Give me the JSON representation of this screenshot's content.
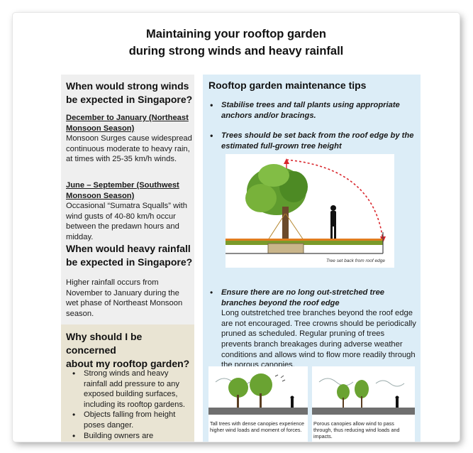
{
  "title": {
    "line1": "Maintaining your rooftop garden",
    "line2": "during strong winds and heavy rainfall"
  },
  "winds": {
    "heading_line1": "When would strong winds",
    "heading_line2": "be expected in Singapore?",
    "ne_label_line1": "December to January (Northeast",
    "ne_label_line2": "Monsoon Season)",
    "ne_text": "Monsoon Surges cause widespread continuous moderate to heavy rain, at times with 25-35 km/h winds.",
    "sw_label_line1": "June – September (Southwest",
    "sw_label_line2": "Monsoon Season)",
    "sw_text": "Occasional “Sumatra Squalls” with wind gusts of 40-80 km/h occur between the predawn hours and midday."
  },
  "rain": {
    "heading_line1": "When would heavy rainfall",
    "heading_line2": "be expected in Singapore?",
    "text": "Higher rainfall occurs from November to January during the wet phase of Northeast Monsoon season."
  },
  "concern": {
    "heading_line1": "Why should I be concerned",
    "heading_line2": "about my rooftop garden?",
    "items": [
      "Strong winds and heavy rainfall add pressure to any exposed building surfaces, including its rooftop gardens.",
      "Objects falling from height poses danger.",
      "Building owners are responsible"
    ]
  },
  "tips": {
    "heading": "Rooftop garden maintenance tips",
    "tip1": "Stabilise trees and tall plants using appropriate anchors and/or bracings.",
    "tip2": "Trees should be set back from the roof edge by the estimated full-grown tree height",
    "tip3_title": "Ensure there are no long out-stretched tree branches beyond the roof edge",
    "tip3_text": "Long outstretched tree branches beyond the roof edge are not encouraged. Tree crowns should be periodically pruned as scheduled. Regular pruning of trees prevents branch breakages during adverse weather conditions and allows wind to flow more readily through the porous canopies.",
    "diagram_label": "Tree set back from roof edge",
    "caption_left": "Tall trees with dense canopies experience higher wind loads and moment of forces.",
    "caption_right": "Porous canopies allow wind to pass through, thus reducing wind loads and impacts."
  },
  "colors": {
    "panel_grey": "#efefef",
    "panel_beige": "#e9e4d3",
    "panel_blue": "#dcedf7",
    "arrow_red": "#d9262c"
  }
}
